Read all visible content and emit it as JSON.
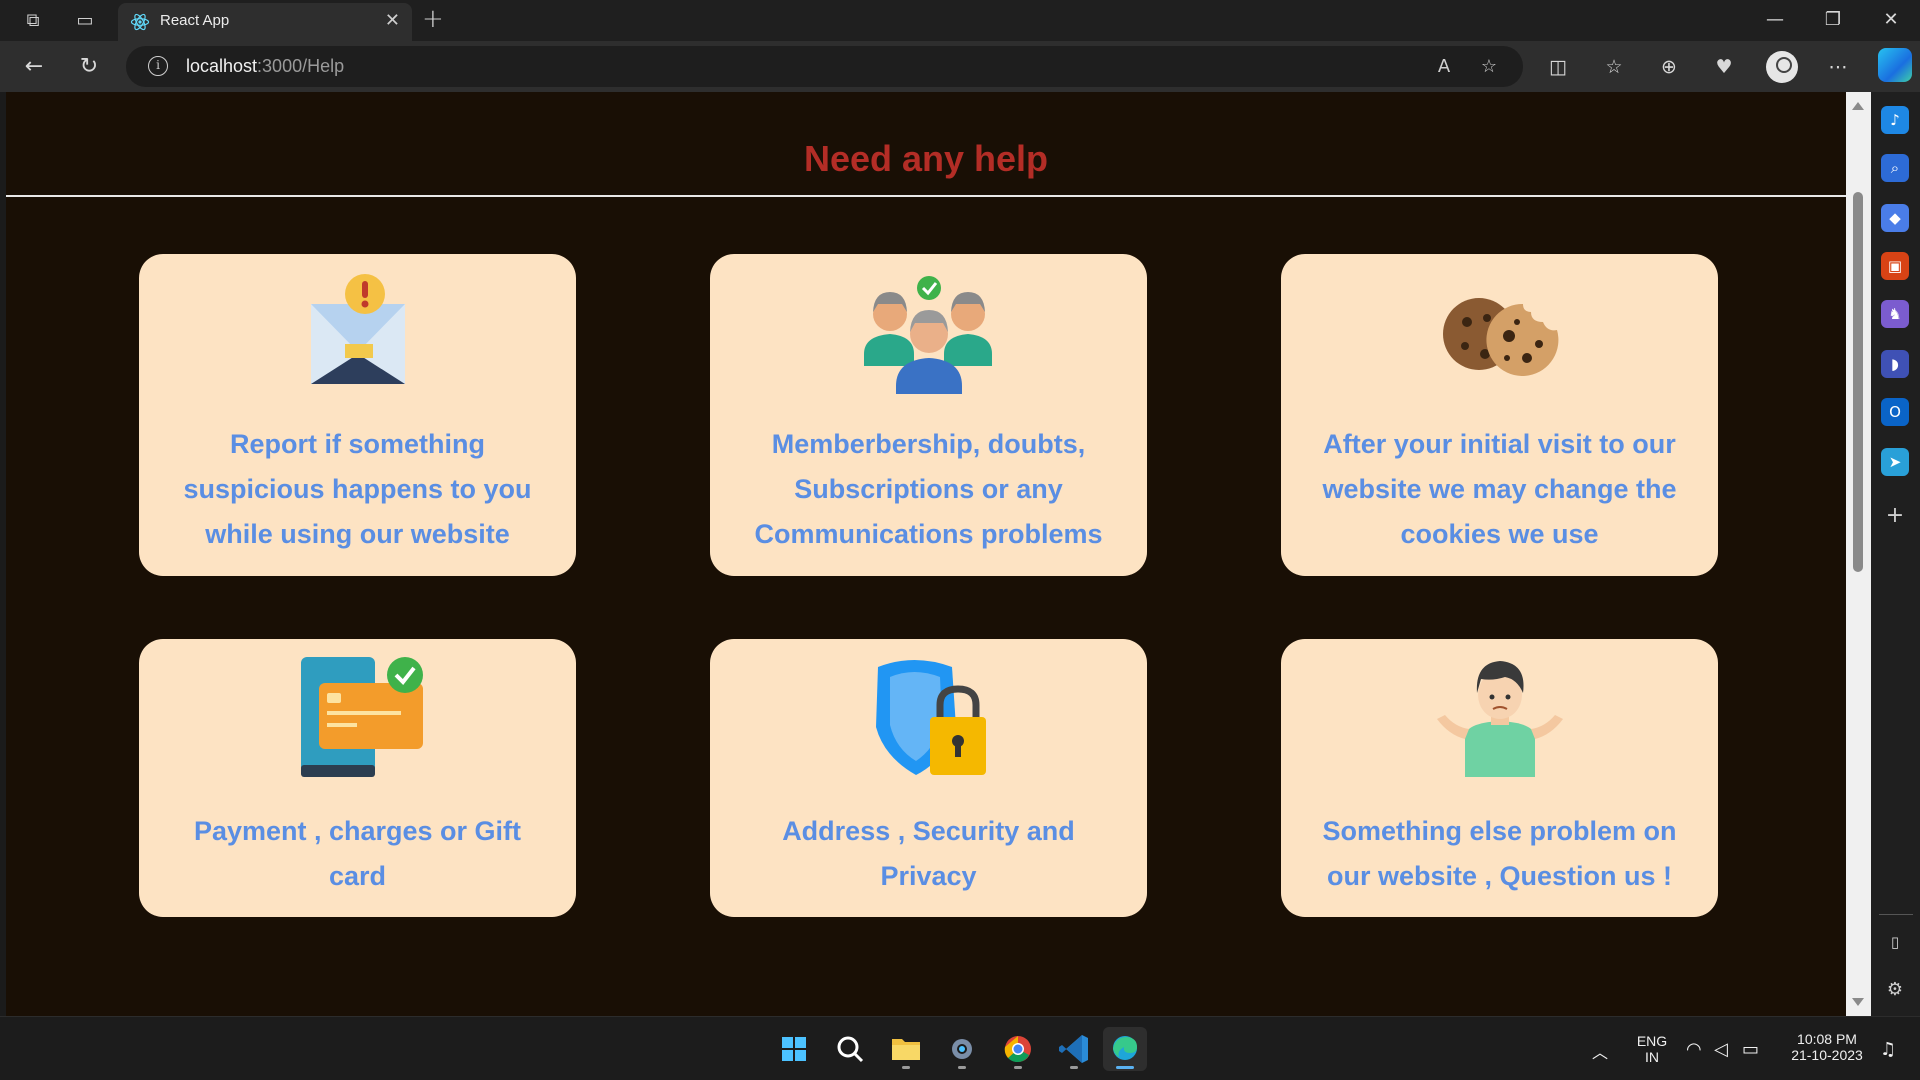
{
  "browser": {
    "tab_title": "React App",
    "tab_close": "✕",
    "new_tab": "+",
    "address_host": "localhost",
    "address_path": ":3000/Help",
    "window_controls": {
      "minimize": "—",
      "restore": "❐",
      "close": "✕"
    }
  },
  "page": {
    "title": "Need any help",
    "colors": {
      "background": "#190f05",
      "title": "#b32d26",
      "card": "#fde3c3",
      "card_text": "#5a8ee3"
    },
    "cards": [
      {
        "icon": "envelope-alert-icon",
        "text": "Report if something suspicious happens to you while using our website"
      },
      {
        "icon": "group-users-icon",
        "text": "Memberbership, doubts, Subscriptions or any Communications problems"
      },
      {
        "icon": "cookies-icon",
        "text": "After your initial visit to our website we may change the cookies we use"
      },
      {
        "icon": "payment-card-icon",
        "text": "Payment , charges or Gift card"
      },
      {
        "icon": "shield-lock-icon",
        "text": "Address , Security and Privacy"
      },
      {
        "icon": "confused-person-icon",
        "text": "Something else problem on our website , Question us !"
      }
    ]
  },
  "taskbar": {
    "lang_line1": "ENG",
    "lang_line2": "IN",
    "time": "10:08 PM",
    "date": "21-10-2023"
  }
}
